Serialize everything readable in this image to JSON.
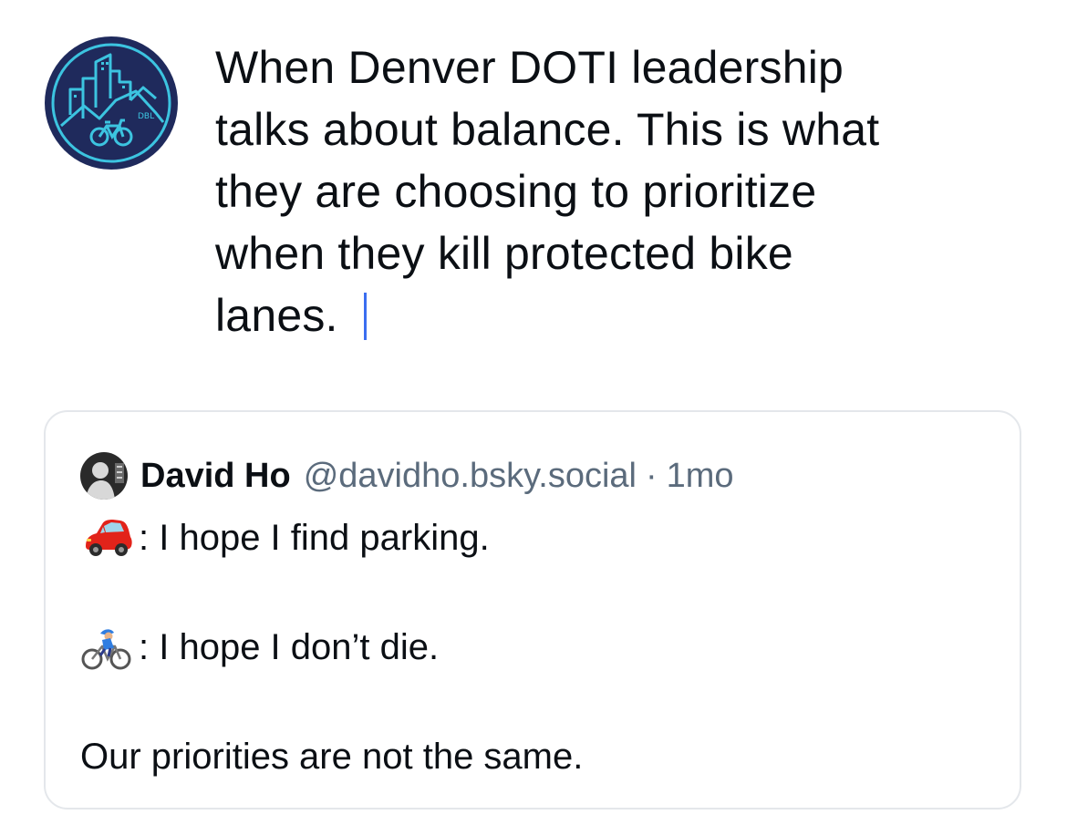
{
  "composer": {
    "avatar_label": "DBL",
    "text_lines": [
      "When Denver DOTI leadership",
      "talks about balance.  This is what",
      "they are choosing to prioritize",
      "when they kill protected bike",
      "lanes."
    ]
  },
  "quote": {
    "author_name": "David Ho",
    "handle": "@davidho.bsky.social",
    "separator": "·",
    "time": "1mo",
    "lines": {
      "car_text": ": I hope I find parking.",
      "bike_text": ": I hope I don’t die.",
      "closing": "Our priorities are not the same."
    },
    "icons": {
      "car": "red-car-emoji-icon",
      "bike": "person-biking-emoji-icon"
    }
  },
  "colors": {
    "cursor": "#3b6ef0",
    "logo_navy": "#1f2a5c",
    "logo_cyan": "#3cc4e0",
    "handle_gray": "#5b6b7c",
    "card_border": "#e4e7eb"
  }
}
